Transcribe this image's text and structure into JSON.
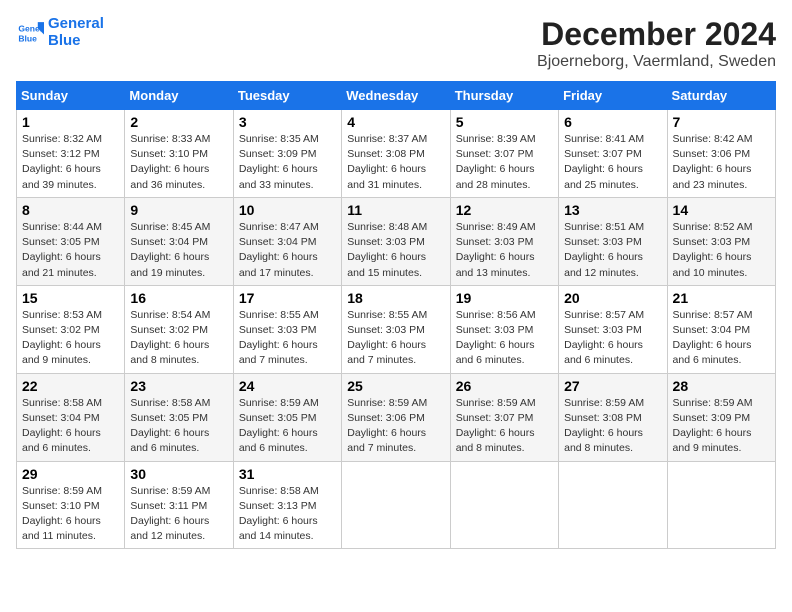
{
  "header": {
    "logo_line1": "General",
    "logo_line2": "Blue",
    "month_title": "December 2024",
    "location": "Bjoerneborg, Vaermland, Sweden"
  },
  "days_of_week": [
    "Sunday",
    "Monday",
    "Tuesday",
    "Wednesday",
    "Thursday",
    "Friday",
    "Saturday"
  ],
  "weeks": [
    [
      {
        "day": "1",
        "sunrise": "8:32 AM",
        "sunset": "3:12 PM",
        "daylight": "6 hours and 39 minutes."
      },
      {
        "day": "2",
        "sunrise": "8:33 AM",
        "sunset": "3:10 PM",
        "daylight": "6 hours and 36 minutes."
      },
      {
        "day": "3",
        "sunrise": "8:35 AM",
        "sunset": "3:09 PM",
        "daylight": "6 hours and 33 minutes."
      },
      {
        "day": "4",
        "sunrise": "8:37 AM",
        "sunset": "3:08 PM",
        "daylight": "6 hours and 31 minutes."
      },
      {
        "day": "5",
        "sunrise": "8:39 AM",
        "sunset": "3:07 PM",
        "daylight": "6 hours and 28 minutes."
      },
      {
        "day": "6",
        "sunrise": "8:41 AM",
        "sunset": "3:07 PM",
        "daylight": "6 hours and 25 minutes."
      },
      {
        "day": "7",
        "sunrise": "8:42 AM",
        "sunset": "3:06 PM",
        "daylight": "6 hours and 23 minutes."
      }
    ],
    [
      {
        "day": "8",
        "sunrise": "8:44 AM",
        "sunset": "3:05 PM",
        "daylight": "6 hours and 21 minutes."
      },
      {
        "day": "9",
        "sunrise": "8:45 AM",
        "sunset": "3:04 PM",
        "daylight": "6 hours and 19 minutes."
      },
      {
        "day": "10",
        "sunrise": "8:47 AM",
        "sunset": "3:04 PM",
        "daylight": "6 hours and 17 minutes."
      },
      {
        "day": "11",
        "sunrise": "8:48 AM",
        "sunset": "3:03 PM",
        "daylight": "6 hours and 15 minutes."
      },
      {
        "day": "12",
        "sunrise": "8:49 AM",
        "sunset": "3:03 PM",
        "daylight": "6 hours and 13 minutes."
      },
      {
        "day": "13",
        "sunrise": "8:51 AM",
        "sunset": "3:03 PM",
        "daylight": "6 hours and 12 minutes."
      },
      {
        "day": "14",
        "sunrise": "8:52 AM",
        "sunset": "3:03 PM",
        "daylight": "6 hours and 10 minutes."
      }
    ],
    [
      {
        "day": "15",
        "sunrise": "8:53 AM",
        "sunset": "3:02 PM",
        "daylight": "6 hours and 9 minutes."
      },
      {
        "day": "16",
        "sunrise": "8:54 AM",
        "sunset": "3:02 PM",
        "daylight": "6 hours and 8 minutes."
      },
      {
        "day": "17",
        "sunrise": "8:55 AM",
        "sunset": "3:03 PM",
        "daylight": "6 hours and 7 minutes."
      },
      {
        "day": "18",
        "sunrise": "8:55 AM",
        "sunset": "3:03 PM",
        "daylight": "6 hours and 7 minutes."
      },
      {
        "day": "19",
        "sunrise": "8:56 AM",
        "sunset": "3:03 PM",
        "daylight": "6 hours and 6 minutes."
      },
      {
        "day": "20",
        "sunrise": "8:57 AM",
        "sunset": "3:03 PM",
        "daylight": "6 hours and 6 minutes."
      },
      {
        "day": "21",
        "sunrise": "8:57 AM",
        "sunset": "3:04 PM",
        "daylight": "6 hours and 6 minutes."
      }
    ],
    [
      {
        "day": "22",
        "sunrise": "8:58 AM",
        "sunset": "3:04 PM",
        "daylight": "6 hours and 6 minutes."
      },
      {
        "day": "23",
        "sunrise": "8:58 AM",
        "sunset": "3:05 PM",
        "daylight": "6 hours and 6 minutes."
      },
      {
        "day": "24",
        "sunrise": "8:59 AM",
        "sunset": "3:05 PM",
        "daylight": "6 hours and 6 minutes."
      },
      {
        "day": "25",
        "sunrise": "8:59 AM",
        "sunset": "3:06 PM",
        "daylight": "6 hours and 7 minutes."
      },
      {
        "day": "26",
        "sunrise": "8:59 AM",
        "sunset": "3:07 PM",
        "daylight": "6 hours and 8 minutes."
      },
      {
        "day": "27",
        "sunrise": "8:59 AM",
        "sunset": "3:08 PM",
        "daylight": "6 hours and 8 minutes."
      },
      {
        "day": "28",
        "sunrise": "8:59 AM",
        "sunset": "3:09 PM",
        "daylight": "6 hours and 9 minutes."
      }
    ],
    [
      {
        "day": "29",
        "sunrise": "8:59 AM",
        "sunset": "3:10 PM",
        "daylight": "6 hours and 11 minutes."
      },
      {
        "day": "30",
        "sunrise": "8:59 AM",
        "sunset": "3:11 PM",
        "daylight": "6 hours and 12 minutes."
      },
      {
        "day": "31",
        "sunrise": "8:58 AM",
        "sunset": "3:13 PM",
        "daylight": "6 hours and 14 minutes."
      },
      null,
      null,
      null,
      null
    ]
  ],
  "labels": {
    "sunrise": "Sunrise:",
    "sunset": "Sunset:",
    "daylight": "Daylight:"
  }
}
